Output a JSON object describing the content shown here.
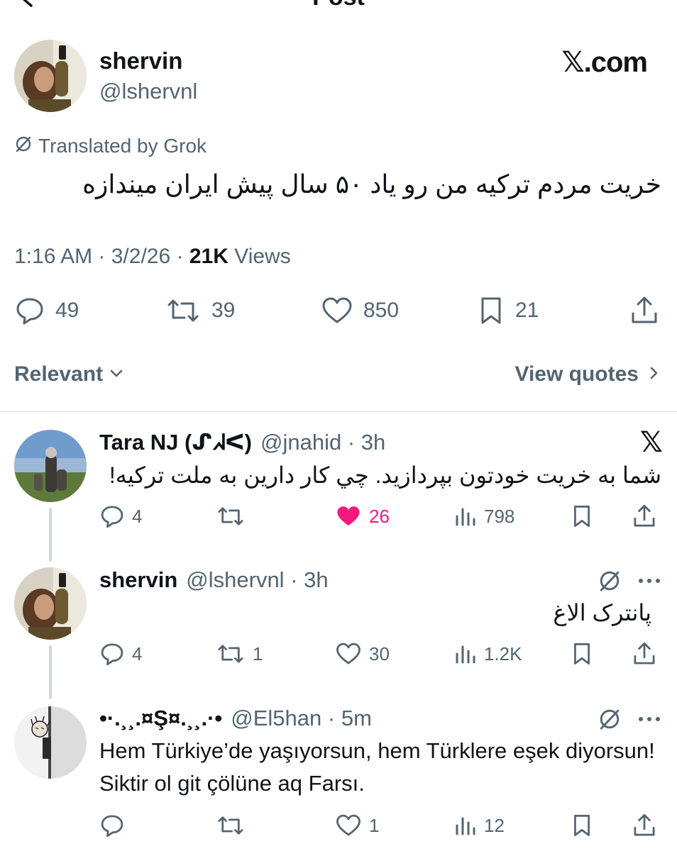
{
  "header": {
    "title": "Post"
  },
  "post": {
    "author_name": "shervin",
    "author_handle": "@lshervnl",
    "brand": "𝕏.com",
    "translated_label": "Translated by Grok",
    "text": "خریت مردم ترکیه من رو یاد ۵۰ سال پیش ایران میندازه",
    "time": "1:16 AM",
    "date": "3/2/26",
    "views_count": "21K",
    "views_label": "Views",
    "replies": "49",
    "reposts": "39",
    "likes": "850",
    "bookmarks": "21"
  },
  "sort": {
    "label": "Relevant",
    "view_quotes": "View quotes"
  },
  "replies": [
    {
      "name": "Tara NJ (ᔑᖽᐸ)",
      "handle": "@jnahid",
      "age": "3h",
      "badge": "𝕏",
      "text": "شما به خریت خودتون بپردازید. چي کار دارين به ملت ترکیه!",
      "replies": "4",
      "reposts": "",
      "likes": "26",
      "views": "798",
      "liked": true
    },
    {
      "name": "shervin",
      "handle": "@lshervnl",
      "age": "3h",
      "text": "پانترک الاغ",
      "replies": "4",
      "reposts": "1",
      "likes": "30",
      "views": "1.2K"
    },
    {
      "name": "•·.¸¸.¤Ş¤.¸¸.·•",
      "handle": "@El5han",
      "age": "5m",
      "text": "Hem Türkiye’de yaşıyorsun, hem Türklere eşek diyorsun! Siktir ol git çölüne aq Farsı.",
      "replies": "",
      "reposts": "",
      "likes": "1",
      "views": "12"
    }
  ],
  "colors": {
    "text": "#0f1419",
    "secondary": "#536471",
    "like": "#f91880",
    "divider": "#d9dee2"
  },
  "icons": [
    "back-arrow-icon",
    "reply-icon",
    "repost-icon",
    "like-icon",
    "bookmark-icon",
    "share-icon",
    "views-icon",
    "grok-icon",
    "more-icon",
    "chevron-down-icon",
    "chevron-right-icon"
  ]
}
